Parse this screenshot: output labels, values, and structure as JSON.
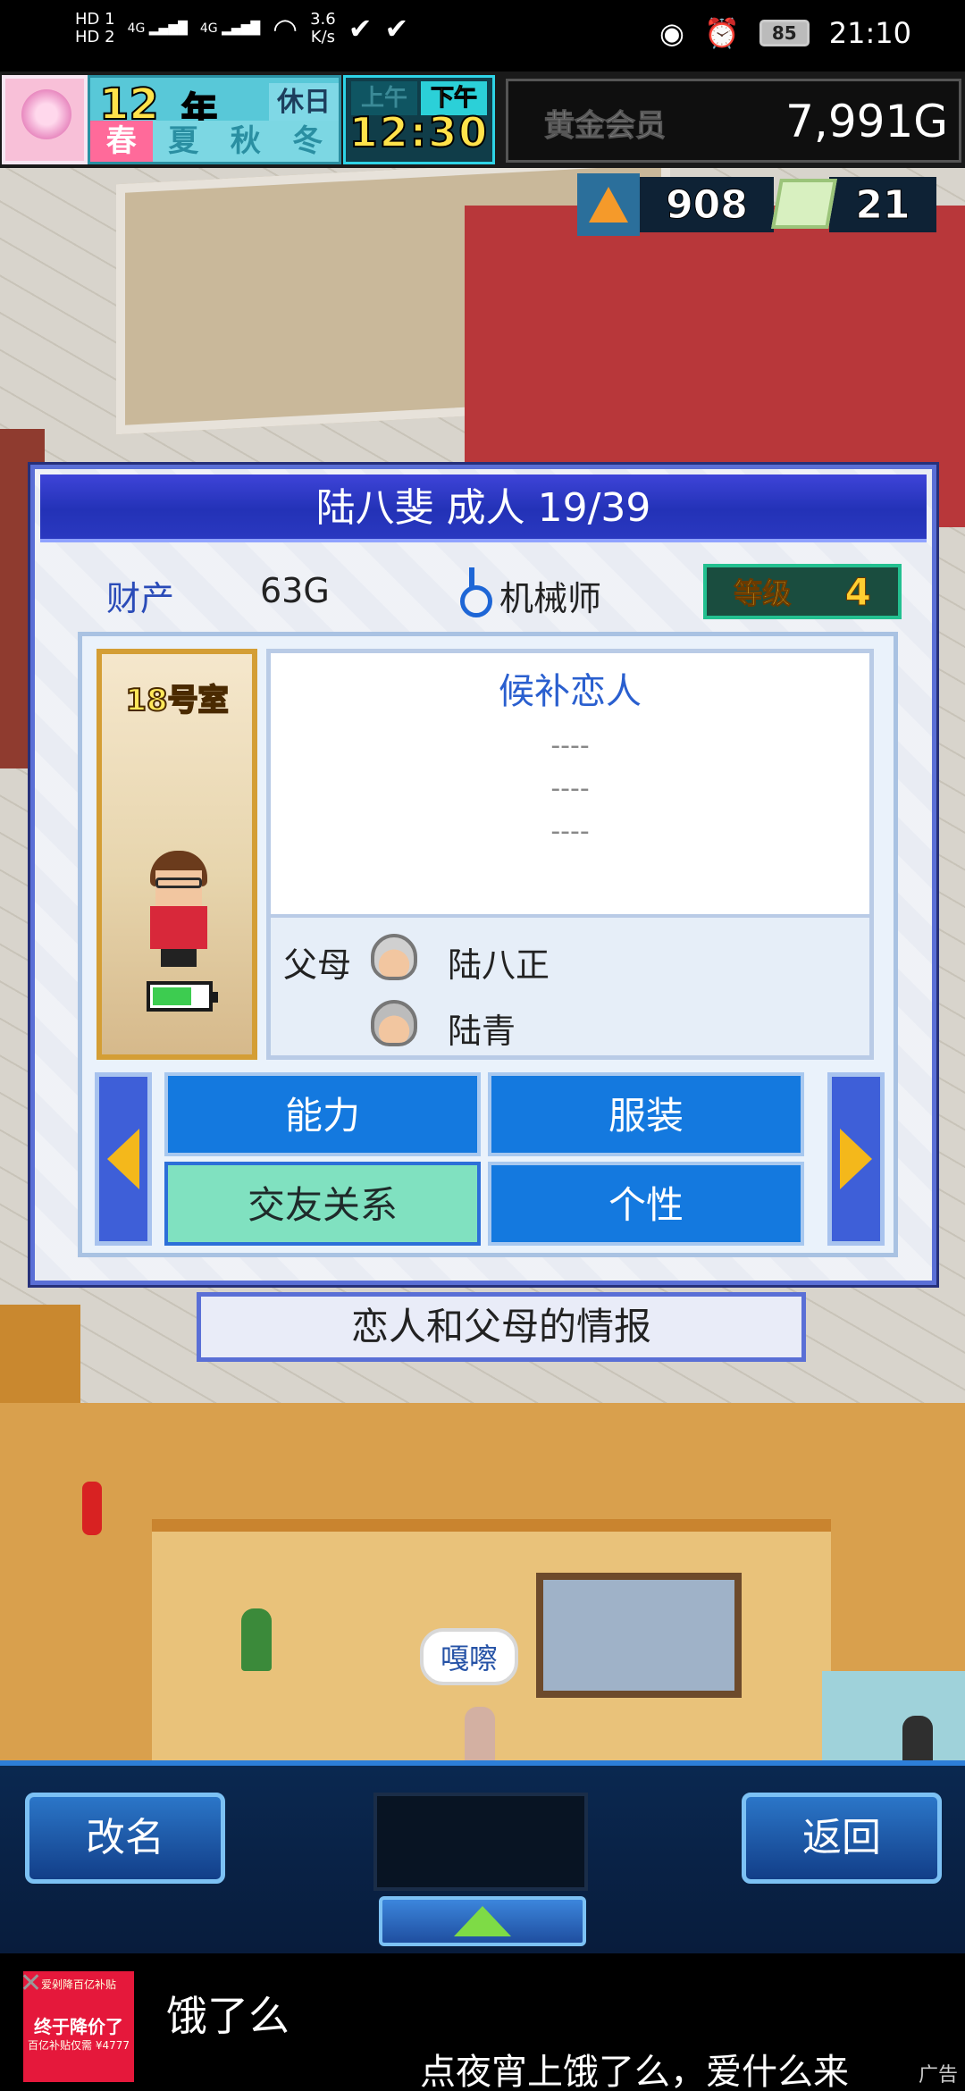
{
  "status_bar": {
    "hd1": "HD 1",
    "hd2": "HD 2",
    "net1": "4G",
    "net2": "4G",
    "speed_value": "3.6",
    "speed_unit": "K/s",
    "battery": "85",
    "time": "21:10"
  },
  "hud": {
    "year": "12",
    "year_unit": "年",
    "holiday": "休日",
    "seasons": [
      "春",
      "夏",
      "秋",
      "冬"
    ],
    "active_season_index": 0,
    "am": "上午",
    "pm": "下午",
    "time": "12:30",
    "member": "黄金会员",
    "money": "7,991G",
    "research_points": "908",
    "tickets": "21"
  },
  "dialog": {
    "title": "陆八斐 成人 19/39",
    "asset_label": "财产",
    "asset_value": "63G",
    "job": "机械师",
    "level_label": "等级",
    "level_value": "4",
    "room": "18号室",
    "energy_level": 0.7,
    "lover_title": "候补恋人",
    "lover_slots": [
      "----",
      "----",
      "----"
    ],
    "parents_label": "父母",
    "parents": [
      "陆八正",
      "陆青"
    ],
    "tabs": [
      "能力",
      "服装",
      "交友关系",
      "个性"
    ],
    "active_tab_index": 2
  },
  "caption": "恋人和父母的情报",
  "scene": {
    "speech_bubble": "嘎嚓"
  },
  "bottom_nav": {
    "rename": "改名",
    "back": "返回"
  },
  "ad": {
    "image_badge": "爱剁降百亿补贴",
    "image_promo": "终于降价了",
    "image_promo2": "百亿补贴仅需 ¥4777",
    "title": "饿了么",
    "text": "点夜宵上饿了么，爱什么来",
    "tag": "广告"
  },
  "colors": {
    "dialog_border": "#5a6fd6",
    "title_bar": "#2332b7",
    "tab_blue": "#1479df",
    "tab_active": "#80e1c0",
    "accent_yellow": "#ffcf31"
  }
}
